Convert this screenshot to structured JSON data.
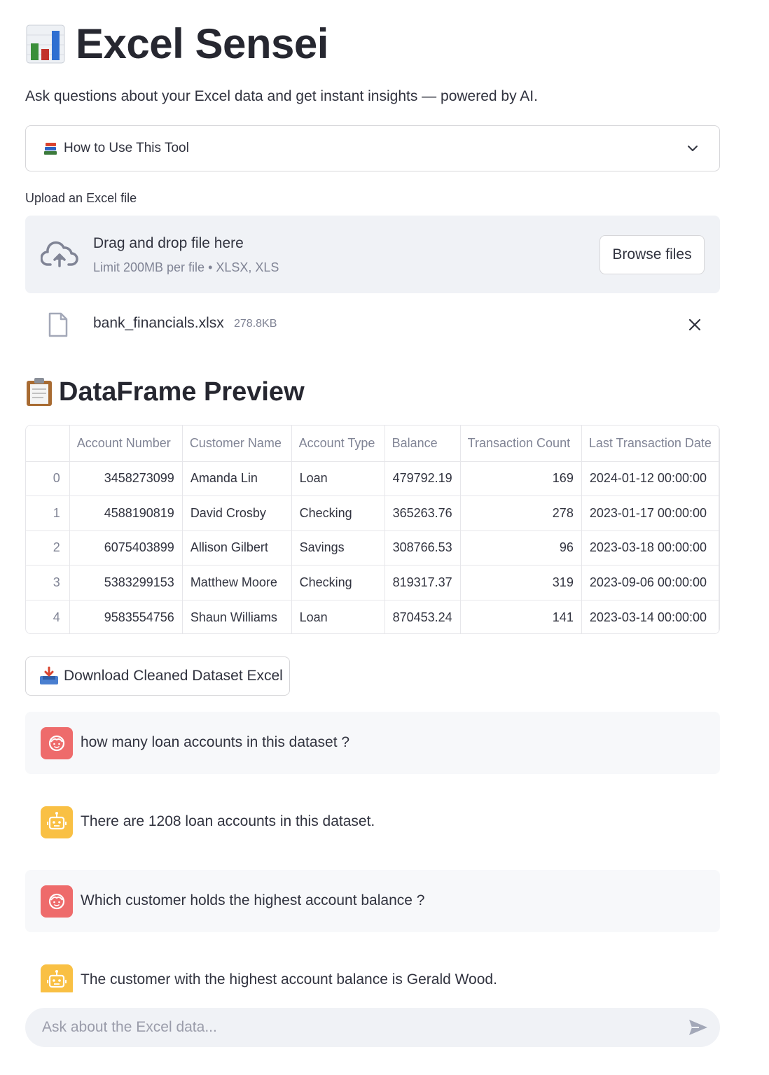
{
  "app": {
    "title": "Excel Sensei",
    "subtitle": "Ask questions about your Excel data and get instant insights — powered by AI.",
    "title_icon": "bar-chart-emoji-icon"
  },
  "expander": {
    "icon": "books-emoji-icon",
    "label": "How to Use This Tool"
  },
  "uploader": {
    "label": "Upload an Excel file",
    "drop_title": "Drag and drop file here",
    "drop_limit": "Limit 200MB per file • XLSX, XLS",
    "browse_label": "Browse files",
    "file": {
      "name": "bank_financials.xlsx",
      "size": "278.8KB"
    }
  },
  "preview": {
    "icon": "clipboard-emoji-icon",
    "title": "DataFrame Preview",
    "columns": [
      "",
      "Account Number",
      "Customer Name",
      "Account Type",
      "Balance",
      "Transaction Count",
      "Last Transaction Date"
    ],
    "rows": [
      [
        "0",
        "3458273099",
        "Amanda Lin",
        "Loan",
        "479792.19",
        "169",
        "2024-01-12 00:00:00"
      ],
      [
        "1",
        "4588190819",
        "David Crosby",
        "Checking",
        "365263.76",
        "278",
        "2023-01-17 00:00:00"
      ],
      [
        "2",
        "6075403899",
        "Allison Gilbert",
        "Savings",
        "308766.53",
        "96",
        "2023-03-18 00:00:00"
      ],
      [
        "3",
        "5383299153",
        "Matthew Moore",
        "Checking",
        "819317.37",
        "319",
        "2023-09-06 00:00:00"
      ],
      [
        "4",
        "9583554756",
        "Shaun Williams",
        "Loan",
        "870453.24",
        "141",
        "2023-03-14 00:00:00"
      ]
    ]
  },
  "download": {
    "icon": "inbox-tray-emoji-icon",
    "label": "Download Cleaned Dataset Excel"
  },
  "chat": {
    "messages": [
      {
        "role": "user",
        "text": "how many loan accounts in this dataset ?"
      },
      {
        "role": "assistant",
        "text": "There are 1208 loan accounts in this dataset."
      },
      {
        "role": "user",
        "text": "Which customer holds the highest account balance ?"
      },
      {
        "role": "assistant",
        "text": "The customer with the highest account balance is Gerald Wood."
      }
    ],
    "input_placeholder": "Ask about the Excel data..."
  },
  "colors": {
    "user_avatar": "#ee6b6b",
    "bot_avatar": "#f9c044",
    "dropzone_bg": "#f0f2f6"
  }
}
